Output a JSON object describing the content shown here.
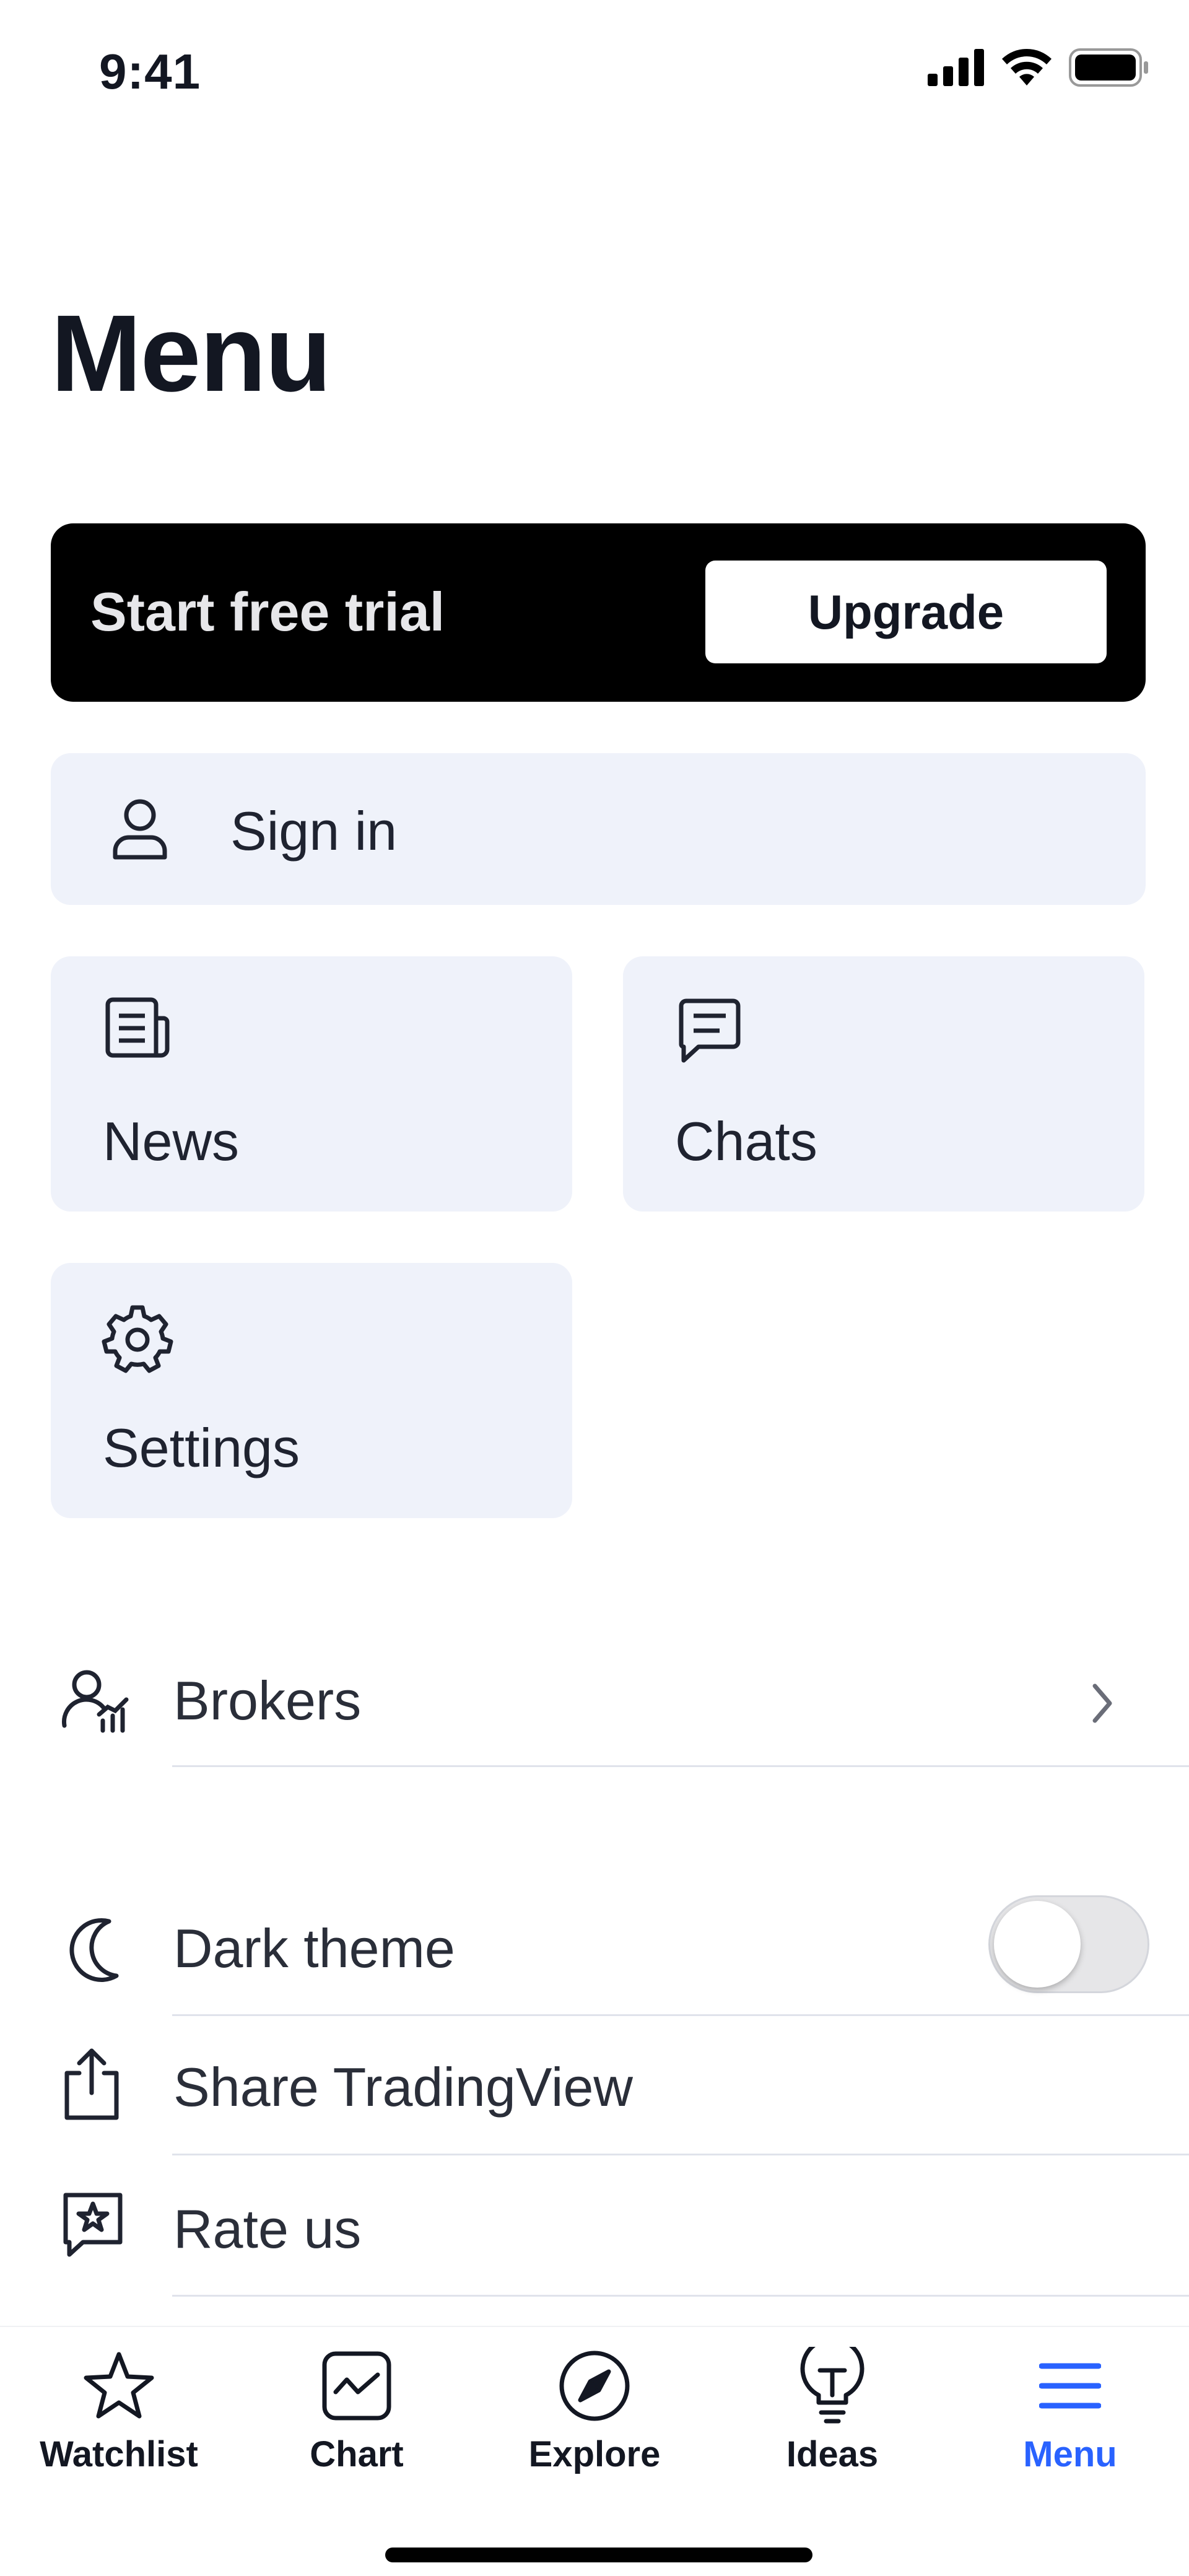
{
  "status_bar": {
    "time": "9:41",
    "icons": [
      "signal-icon",
      "wifi-icon",
      "battery-icon"
    ]
  },
  "page": {
    "title": "Menu"
  },
  "promo": {
    "text": "Start free trial",
    "button_label": "Upgrade"
  },
  "signin": {
    "label": "Sign in",
    "icon": "user-icon"
  },
  "tiles": [
    {
      "label": "News",
      "icon": "news-icon"
    },
    {
      "label": "Chats",
      "icon": "chat-icon"
    },
    {
      "label": "Settings",
      "icon": "gear-icon"
    }
  ],
  "list": {
    "brokers": {
      "label": "Brokers",
      "icon": "brokers-icon"
    },
    "dark_theme": {
      "label": "Dark theme",
      "icon": "moon-icon",
      "enabled": false
    },
    "share": {
      "label": "Share TradingView",
      "icon": "share-icon"
    },
    "rate": {
      "label": "Rate us",
      "icon": "rate-icon"
    }
  },
  "tabbar": {
    "tabs": [
      {
        "label": "Watchlist",
        "icon": "star-icon"
      },
      {
        "label": "Chart",
        "icon": "chart-icon"
      },
      {
        "label": "Explore",
        "icon": "compass-icon"
      },
      {
        "label": "Ideas",
        "icon": "lightbulb-icon"
      },
      {
        "label": "Menu",
        "icon": "hamburger-icon",
        "active": true
      }
    ]
  },
  "colors": {
    "accent": "#2962ff",
    "tile_bg": "#eff2fa",
    "promo_bg": "#000000",
    "text": "#131722"
  }
}
